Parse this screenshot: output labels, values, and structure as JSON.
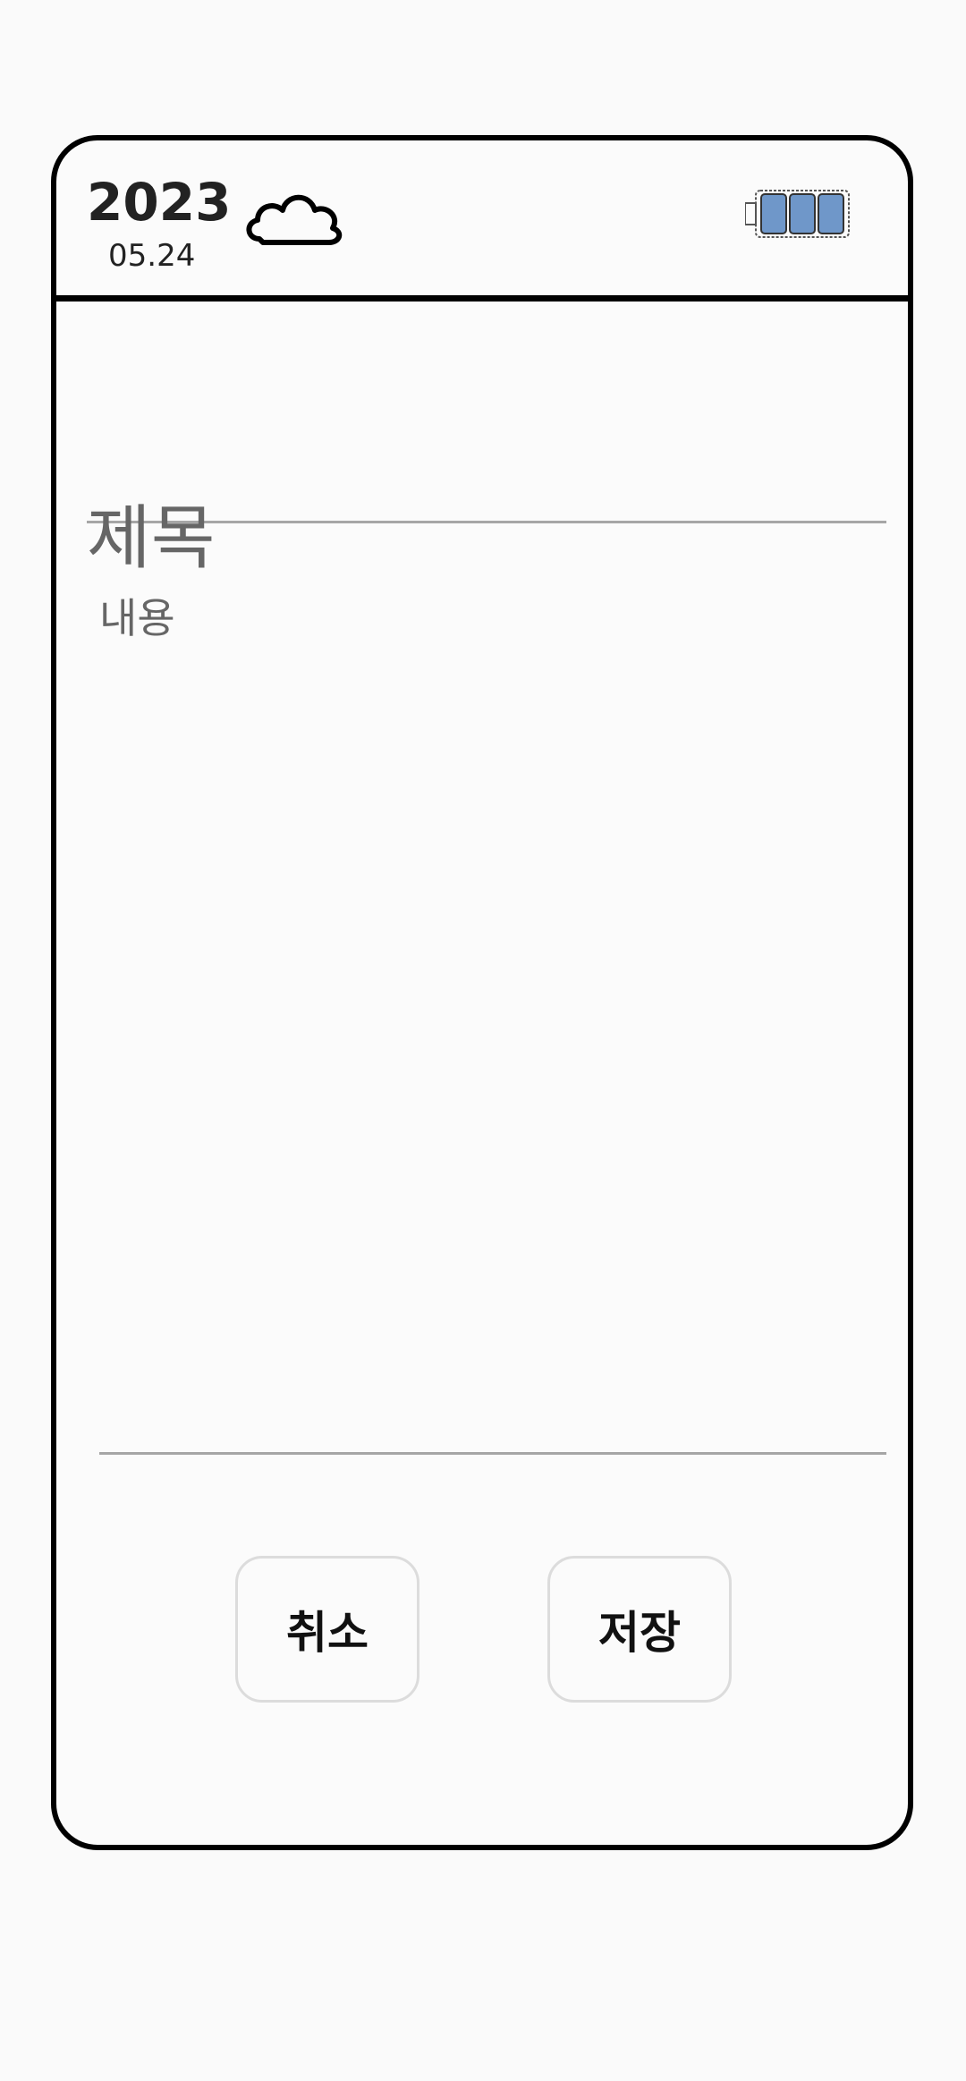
{
  "header": {
    "year": "2023",
    "date": "05.24",
    "weather_icon": "cloud-icon",
    "battery_icon": "battery-icon",
    "battery_level_bars": 3,
    "battery_color": "#6f97c9"
  },
  "editor": {
    "title_placeholder": "제목",
    "body_placeholder": "내용"
  },
  "actions": {
    "cancel_label": "취소",
    "save_label": "저장"
  }
}
